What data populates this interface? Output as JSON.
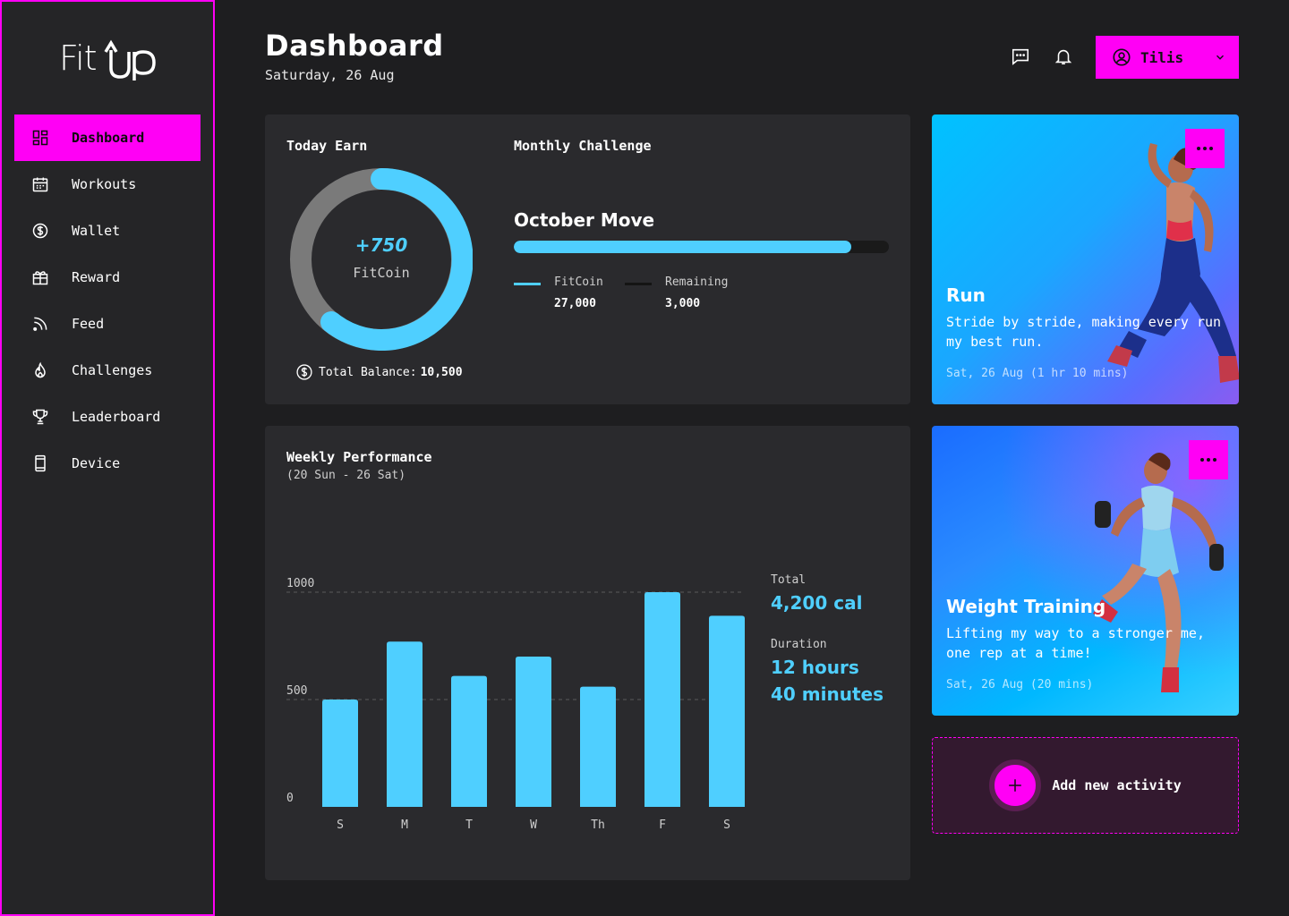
{
  "app": {
    "logo": "FitUp"
  },
  "sidebar": {
    "items": [
      {
        "label": "Dashboard",
        "icon": "dashboard-icon",
        "active": true
      },
      {
        "label": "Workouts",
        "icon": "calendar-icon"
      },
      {
        "label": "Wallet",
        "icon": "dollar-coin-icon"
      },
      {
        "label": "Reward",
        "icon": "gift-icon"
      },
      {
        "label": "Feed",
        "icon": "rss-icon"
      },
      {
        "label": "Challenges",
        "icon": "flame-icon"
      },
      {
        "label": "Leaderboard",
        "icon": "trophy-icon"
      },
      {
        "label": "Device",
        "icon": "phone-device-icon"
      }
    ]
  },
  "header": {
    "title": "Dashboard",
    "date": "Saturday, 26 Aug",
    "user_name": "Tilis"
  },
  "today_earn": {
    "title": "Today Earn",
    "value": "+750",
    "unit": "FitCoin",
    "balance_label": "Total Balance:",
    "balance_value": "10,500"
  },
  "monthly_challenge": {
    "title": "Monthly Challenge",
    "name": "October Move",
    "progress": 0.9,
    "legend": [
      {
        "label": "FitCoin",
        "value": "27,000",
        "color": "#4fcfff"
      },
      {
        "label": "Remaining",
        "value": "3,000",
        "color": "#1a1a1a"
      }
    ]
  },
  "weekly": {
    "title": "Weekly Performance",
    "subtitle": "(20 Sun - 26 Sat)",
    "total_label": "Total",
    "total_value": "4,200 cal",
    "duration_label": "Duration",
    "duration_hours": "12 hours",
    "duration_minutes": "40 minutes"
  },
  "chart_data": {
    "type": "bar",
    "categories": [
      "S",
      "M",
      "T",
      "W",
      "Th",
      "F",
      "S"
    ],
    "values": [
      500,
      770,
      610,
      700,
      560,
      1000,
      890
    ],
    "ylim": [
      0,
      1000
    ],
    "yticks": [
      "1000",
      "500",
      "0"
    ],
    "grid": true,
    "color": "#4fcfff"
  },
  "activities": [
    {
      "title": "Run",
      "desc": "Stride by stride, making every run my best run.",
      "date": "Sat, 26 Aug (1 hr 10 mins)"
    },
    {
      "title": "Weight Training",
      "desc": "Lifting my way to a stronger me, one rep at a time!",
      "date": "Sat, 26 Aug (20 mins)"
    }
  ],
  "add_activity": {
    "label": "Add new activity"
  },
  "colors": {
    "accent": "#ff00f5",
    "cyan": "#4fcfff",
    "background": "#1e1e20",
    "card": "#2a2a2d"
  }
}
